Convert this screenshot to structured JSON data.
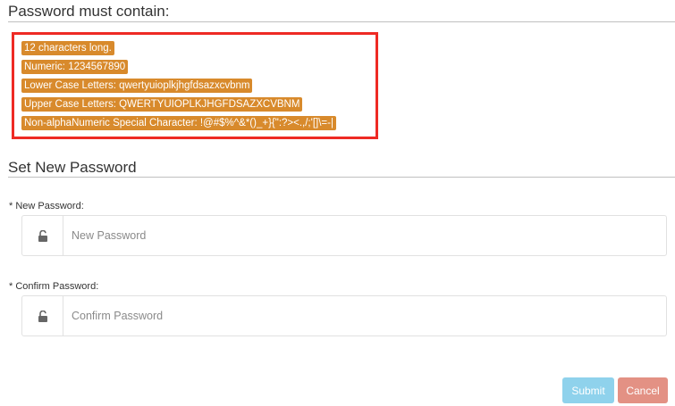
{
  "requirements": {
    "heading": "Password must contain:",
    "items": [
      "12 characters long.",
      "Numeric: 1234567890",
      "Lower Case Letters: qwertyuioplkjhgfdsazxcvbnm",
      "Upper Case Letters: QWERTYUIOPLKJHGFDSAZXCVBNM",
      "Non-alphaNumeric Special Character: !@#$%^&*()_+}{\":?><.,/;'[]\\=-|"
    ],
    "chip_color": "#d88a2c",
    "highlight_color": "#ee2a24"
  },
  "form": {
    "heading": "Set New Password",
    "new_password": {
      "label": "* New Password:",
      "placeholder": "New Password",
      "icon": "unlock-icon"
    },
    "confirm_password": {
      "label": "* Confirm Password:",
      "placeholder": "Confirm Password",
      "icon": "unlock-icon"
    }
  },
  "actions": {
    "submit_label": "Submit",
    "cancel_label": "Cancel",
    "submit_color": "#8fd2ec",
    "cancel_color": "#e39184"
  }
}
